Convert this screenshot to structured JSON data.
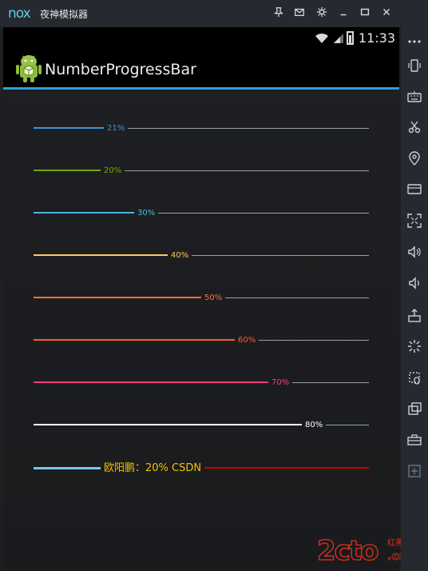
{
  "window": {
    "brand": "nox",
    "title": "夜神模拟器"
  },
  "status": {
    "time": "11:33"
  },
  "app": {
    "title": "NumberProgressBar"
  },
  "progress_bars": [
    {
      "label": "21%",
      "value": 21,
      "fill_color": "#3498db"
    },
    {
      "label": "20%",
      "value": 20,
      "fill_color": "#70a800"
    },
    {
      "label": "30%",
      "value": 30,
      "fill_color": "#4fb5dd"
    },
    {
      "label": "40%",
      "value": 40,
      "fill_color": "#fec75f"
    },
    {
      "label": "50%",
      "value": 50,
      "fill_color": "#ff6f3f"
    },
    {
      "label": "60%",
      "value": 60,
      "fill_color": "#ff5a2d"
    },
    {
      "label": "70%",
      "value": 70,
      "fill_color": "#ff3d71"
    },
    {
      "label": "80%",
      "value": 80,
      "fill_color": "#ffffff"
    },
    {
      "label": "欧阳鹏：20%  CSDN",
      "value": 20,
      "fill_color": "#79c5ef",
      "text_color": "#f0c000",
      "track_color": "#cc0000"
    }
  ],
  "watermark": {
    "text": "2cto",
    "suffix": ".com",
    "caption": "红黑联盟"
  },
  "sidebar": [
    "menu-icon",
    "phone-shake-icon",
    "keyboard-icon",
    "scissors-icon",
    "location-icon",
    "screen-icon",
    "fullscreen-icon",
    "volume-up-icon",
    "volume-down-icon",
    "apk-install-icon",
    "loading-icon",
    "macro-icon",
    "multi-instance-icon",
    "toolbox-icon",
    "add-icon"
  ]
}
